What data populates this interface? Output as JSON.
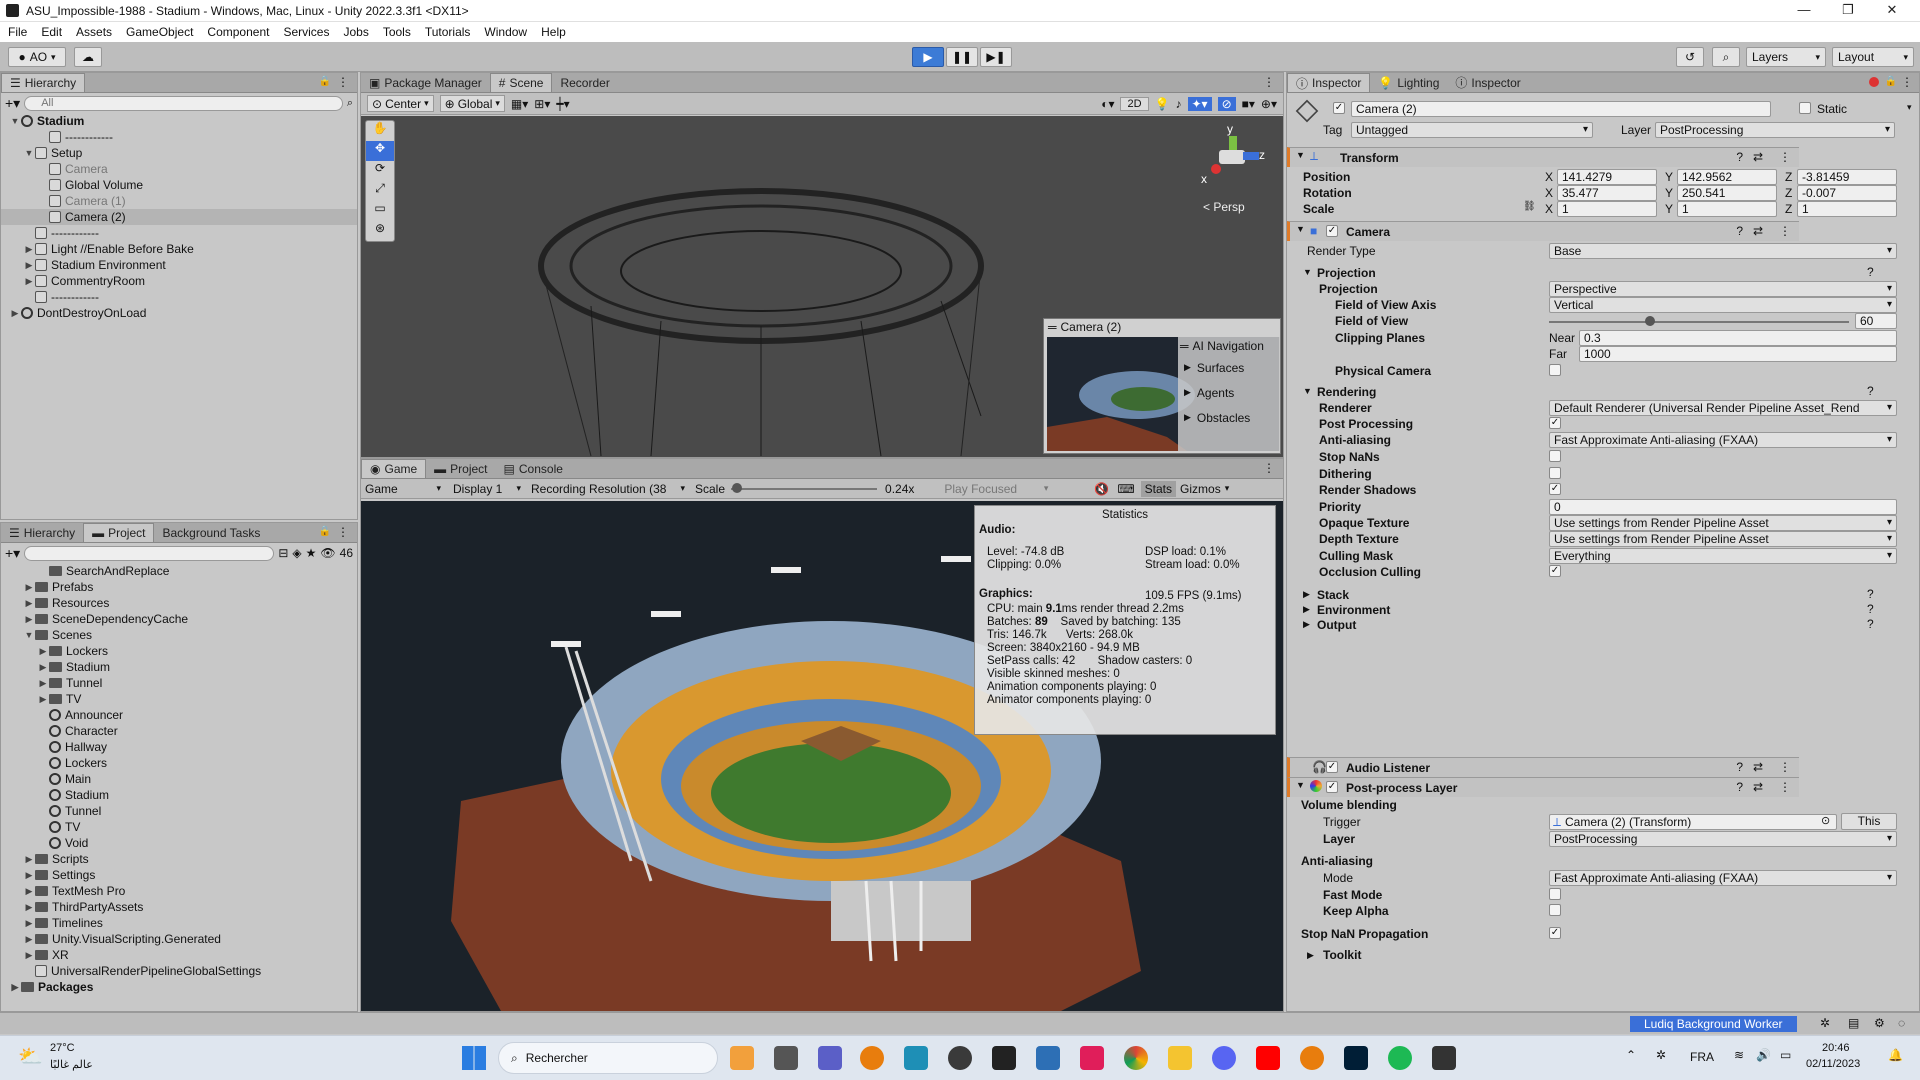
{
  "window": {
    "title": "ASU_Impossible-1988 - Stadium - Windows, Mac, Linux - Unity 2022.3.3f1 <DX11>"
  },
  "menu": [
    "File",
    "Edit",
    "Assets",
    "GameObject",
    "Component",
    "Services",
    "Jobs",
    "Tools",
    "Tutorials",
    "Window",
    "Help"
  ],
  "toolbar": {
    "account": "AO",
    "layers": "Layers",
    "layout": "Layout"
  },
  "hierarchy": {
    "tab": "Hierarchy",
    "search_placeholder": "All",
    "items": [
      {
        "label": "Stadium",
        "indent": 0,
        "type": "scene",
        "bold": true,
        "tri": "▼"
      },
      {
        "label": "------------",
        "indent": 2,
        "type": "go"
      },
      {
        "label": "Setup",
        "indent": 1,
        "type": "go",
        "tri": "▼"
      },
      {
        "label": "Camera",
        "indent": 2,
        "type": "go",
        "dim": true
      },
      {
        "label": "Global Volume",
        "indent": 2,
        "type": "go"
      },
      {
        "label": "Camera (1)",
        "indent": 2,
        "type": "go",
        "dim": true
      },
      {
        "label": "Camera (2)",
        "indent": 2,
        "type": "go",
        "sel": true
      },
      {
        "label": "------------",
        "indent": 1,
        "type": "go"
      },
      {
        "label": "Light //Enable Before Bake",
        "indent": 1,
        "type": "go",
        "tri": "▶"
      },
      {
        "label": "Stadium Environment",
        "indent": 1,
        "type": "go",
        "tri": "▶"
      },
      {
        "label": "CommentryRoom",
        "indent": 1,
        "type": "go",
        "tri": "▶"
      },
      {
        "label": "------------",
        "indent": 1,
        "type": "go"
      },
      {
        "label": "DontDestroyOnLoad",
        "indent": 0,
        "type": "scene",
        "tri": "▶"
      }
    ]
  },
  "project": {
    "tabs": [
      "Hierarchy",
      "Project",
      "Background Tasks"
    ],
    "count": "46",
    "items": [
      {
        "label": "SearchAndReplace",
        "indent": 2,
        "type": "fold"
      },
      {
        "label": "Prefabs",
        "indent": 1,
        "type": "fold",
        "tri": "▶"
      },
      {
        "label": "Resources",
        "indent": 1,
        "type": "fold",
        "tri": "▶"
      },
      {
        "label": "SceneDependencyCache",
        "indent": 1,
        "type": "fold",
        "tri": "▶"
      },
      {
        "label": "Scenes",
        "indent": 1,
        "type": "fold",
        "tri": "▼"
      },
      {
        "label": "Lockers",
        "indent": 2,
        "type": "fold",
        "tri": "▶"
      },
      {
        "label": "Stadium",
        "indent": 2,
        "type": "fold",
        "tri": "▶"
      },
      {
        "label": "Tunnel",
        "indent": 2,
        "type": "fold",
        "tri": "▶"
      },
      {
        "label": "TV",
        "indent": 2,
        "type": "fold",
        "tri": "▶"
      },
      {
        "label": "Announcer",
        "indent": 2,
        "type": "scene"
      },
      {
        "label": "Character",
        "indent": 2,
        "type": "scene"
      },
      {
        "label": "Hallway",
        "indent": 2,
        "type": "scene"
      },
      {
        "label": "Lockers",
        "indent": 2,
        "type": "scene"
      },
      {
        "label": "Main",
        "indent": 2,
        "type": "scene"
      },
      {
        "label": "Stadium",
        "indent": 2,
        "type": "scene"
      },
      {
        "label": "Tunnel",
        "indent": 2,
        "type": "scene"
      },
      {
        "label": "TV",
        "indent": 2,
        "type": "scene"
      },
      {
        "label": "Void",
        "indent": 2,
        "type": "scene"
      },
      {
        "label": "Scripts",
        "indent": 1,
        "type": "fold",
        "tri": "▶"
      },
      {
        "label": "Settings",
        "indent": 1,
        "type": "fold",
        "tri": "▶"
      },
      {
        "label": "TextMesh Pro",
        "indent": 1,
        "type": "fold",
        "tri": "▶"
      },
      {
        "label": "ThirdPartyAssets",
        "indent": 1,
        "type": "fold",
        "tri": "▶"
      },
      {
        "label": "Timelines",
        "indent": 1,
        "type": "fold",
        "tri": "▶"
      },
      {
        "label": "Unity.VisualScripting.Generated",
        "indent": 1,
        "type": "fold",
        "tri": "▶"
      },
      {
        "label": "XR",
        "indent": 1,
        "type": "fold",
        "tri": "▶"
      },
      {
        "label": "UniversalRenderPipelineGlobalSettings",
        "indent": 1,
        "type": "asset"
      },
      {
        "label": "Packages",
        "indent": 0,
        "type": "fold",
        "tri": "▶",
        "bold": true
      }
    ]
  },
  "scene": {
    "tabs": [
      "Package Manager",
      "Scene",
      "Recorder"
    ],
    "pivot": "Center",
    "space": "Global",
    "mode2d": "2D",
    "persp": "< Persp",
    "cam_preview": "Camera (2)",
    "ai_nav": {
      "title": "AI Navigation",
      "items": [
        "Surfaces",
        "Agents",
        "Obstacles"
      ]
    },
    "gizmo": {
      "y": "y",
      "z": "z",
      "x": "x"
    }
  },
  "game": {
    "tabs": [
      "Game",
      "Project",
      "Console"
    ],
    "view": "Game",
    "display": "Display 1",
    "resolution": "Recording Resolution (38",
    "scale_label": "Scale",
    "scale_value": "0.24x",
    "play_focused": "Play Focused",
    "stats_btn": "Stats",
    "gizmos_btn": "Gizmos",
    "scale_fraction": 0.01
  },
  "stats": {
    "title": "Statistics",
    "audio_h": "Audio:",
    "level": "Level: -74.8 dB",
    "dsp": "DSP load: 0.1%",
    "clipping": "Clipping: 0.0%",
    "stream": "Stream load: 0.0%",
    "graphics_h": "Graphics:",
    "fps": "109.5 FPS (9.1ms)",
    "lines": [
      [
        "CPU: main ",
        "9.1",
        "ms  render thread 2.2ms"
      ],
      [
        "Batches: ",
        "89",
        "    Saved by batching: 135"
      ]
    ],
    "plain": [
      "Tris: 146.7k      Verts: 268.0k",
      "Screen: 3840x2160 - 94.9 MB",
      "SetPass calls: 42       Shadow casters: 0",
      "Visible skinned meshes: 0",
      "Animation components playing: 0",
      "Animator components playing: 0"
    ]
  },
  "inspector": {
    "tabs": [
      "Inspector",
      "Lighting",
      "Inspector"
    ],
    "object": "Camera (2)",
    "static": "Static",
    "tag_label": "Tag",
    "tag": "Untagged",
    "layer_label": "Layer",
    "layer": "PostProcessing",
    "transform": {
      "title": "Transform",
      "pos_label": "Position",
      "rot_label": "Rotation",
      "scale_label": "Scale",
      "pos": [
        "141.4279",
        "142.9562",
        "-3.81459"
      ],
      "rot": [
        "35.477",
        "250.541",
        "-0.007"
      ],
      "scale": [
        "1",
        "1",
        "1"
      ],
      "axes": [
        "X",
        "Y",
        "Z"
      ]
    },
    "camera": {
      "title": "Camera",
      "render_type_label": "Render Type",
      "render_type": "Base",
      "projection_h": "Projection",
      "projection_label": "Projection",
      "projection": "Perspective",
      "fov_axis_label": "Field of View Axis",
      "fov_axis": "Vertical",
      "fov_label": "Field of View",
      "fov": "60",
      "fov_fraction": 0.33,
      "clip_label": "Clipping Planes",
      "near_label": "Near",
      "near": "0.3",
      "far_label": "Far",
      "far": "1000",
      "physical_label": "Physical Camera",
      "rendering_h": "Rendering",
      "renderer_label": "Renderer",
      "renderer": "Default Renderer (Universal Render Pipeline Asset_Rend",
      "post_label": "Post Processing",
      "aa_label": "Anti-aliasing",
      "aa": "Fast Approximate Anti-aliasing (FXAA)",
      "stopnan_label": "Stop NaNs",
      "dither_label": "Dithering",
      "shadows_label": "Render Shadows",
      "priority_label": "Priority",
      "priority": "0",
      "opaque_label": "Opaque Texture",
      "opaque": "Use settings from Render Pipeline Asset",
      "depth_label": "Depth Texture",
      "depth": "Use settings from Render Pipeline Asset",
      "culling_label": "Culling Mask",
      "culling": "Everything",
      "occlusion_label": "Occlusion Culling",
      "stack": "Stack",
      "environment": "Environment",
      "output": "Output"
    },
    "audio_listener": "Audio Listener",
    "ppl": {
      "title": "Post-process Layer",
      "vb": "Volume blending",
      "trigger_label": "Trigger",
      "trigger": "Camera (2) (Transform)",
      "this_btn": "This",
      "layer_label": "Layer",
      "layer": "PostProcessing",
      "aa_h": "Anti-aliasing",
      "mode_label": "Mode",
      "mode": "Fast Approximate Anti-aliasing (FXAA)",
      "fast_label": "Fast Mode",
      "alpha_label": "Keep Alpha",
      "stopnan_label": "Stop NaN Propagation",
      "toolkit": "Toolkit"
    }
  },
  "status": {
    "worker": "Ludiq Background Worker"
  },
  "taskbar": {
    "temp": "27°C",
    "weather": "عالم غالبًا",
    "search": "Rechercher",
    "lang": "FRA",
    "time": "20:46",
    "date": "02/11/2023"
  },
  "colors": {
    "accent": "#3a6fd8",
    "selection": "#b4b4b4",
    "play": "#3c7bd6",
    "game_bg": "#1b2229"
  }
}
